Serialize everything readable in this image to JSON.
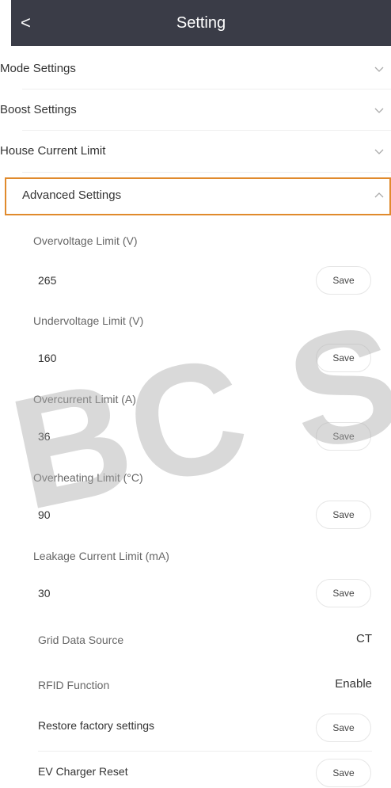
{
  "header": {
    "back_label": "<",
    "title": "Setting"
  },
  "sections": [
    {
      "label": "Mode Settings"
    },
    {
      "label": "Boost Settings"
    },
    {
      "label": "House Current Limit"
    },
    {
      "label": "Advanced Settings"
    }
  ],
  "advanced": {
    "fields": [
      {
        "label": "Overvoltage Limit (V)",
        "value": "265",
        "button": "Save"
      },
      {
        "label": "Undervoltage Limit (V)",
        "value": "160",
        "button": "Save"
      },
      {
        "label": "Overcurrent Limit (A)",
        "value": "36",
        "button": "Save"
      },
      {
        "label": "Overheating Limit (°C)",
        "value": "90",
        "button": "Save"
      },
      {
        "label": "Leakage Current Limit (mA)",
        "value": "30",
        "button": "Save"
      }
    ],
    "grid_data_source": {
      "label": "Grid Data Source",
      "value": "CT"
    },
    "rfid_function": {
      "label": "RFID Function",
      "value": "Enable"
    },
    "restore_factory": {
      "label": "Restore factory settings",
      "button": "Save"
    },
    "ev_reset": {
      "label": "EV Charger Reset",
      "button": "Save"
    }
  },
  "watermark": {
    "text": "BC Soli"
  },
  "icons": {
    "collapsed": "chevron-down-icon",
    "expanded": "chevron-up-icon"
  },
  "colors": {
    "header_bg": "#3a3c47",
    "highlight_border": "#e08a2c"
  }
}
